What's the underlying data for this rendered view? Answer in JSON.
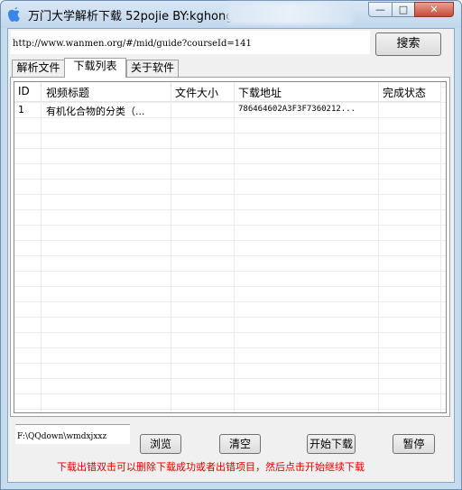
{
  "window": {
    "title": "万门大学解析下载 52pojie BY:kghong",
    "controls": {
      "minimize": "—",
      "maximize": "□",
      "close": "✕"
    },
    "icon": "apple-icon"
  },
  "url_bar": {
    "value": "http://www.wanmen.org/#/mid/guide?courseId=141"
  },
  "search_button": "搜索",
  "tabs": [
    {
      "label": "解析文件",
      "active": false
    },
    {
      "label": "下载列表",
      "active": true
    },
    {
      "label": "关于软件",
      "active": false
    }
  ],
  "table": {
    "columns": [
      "ID",
      "视频标题",
      "文件大小",
      "下载地址",
      "完成状态"
    ],
    "rows": [
      {
        "id": "1",
        "title": "有机化合物的分类（...",
        "size": "",
        "url": "786464602A3F3F7360212...",
        "status": ""
      }
    ]
  },
  "bottom": {
    "path_value": "F:\\QQdown\\wmdxjxxz",
    "browse": "浏览",
    "clear": "清空",
    "start": "开始下载",
    "pause": "暂停",
    "hint": "下载出错双击可以删除下载成功或者出错项目，然后点击开始继续下载"
  },
  "colors": {
    "hint": "#e60000",
    "title_bar": "#c5dbee",
    "close_button": "#c74a36"
  }
}
